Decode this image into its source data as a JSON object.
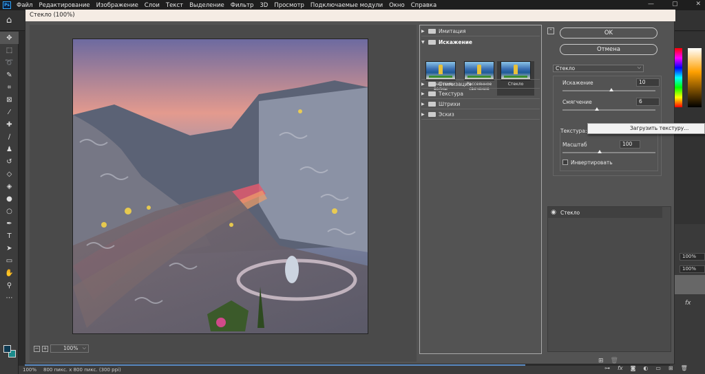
{
  "app": {
    "logo": "Ps",
    "menu": [
      "Файл",
      "Редактирование",
      "Изображение",
      "Слои",
      "Текст",
      "Выделение",
      "Фильтр",
      "3D",
      "Просмотр",
      "Подключаемые модули",
      "Окно",
      "Справка"
    ],
    "window_controls": [
      "—",
      "▢",
      "✕"
    ]
  },
  "toolbar": {
    "icons": [
      "move-icon",
      "marquee-icon",
      "lasso-icon",
      "quick-select-icon",
      "crop-icon",
      "frame-icon",
      "eyedropper-icon",
      "healing-icon",
      "brush-icon",
      "stamp-icon",
      "history-brush-icon",
      "eraser-icon",
      "bucket-icon",
      "blur-icon",
      "dodge-icon",
      "pen-icon",
      "type-icon",
      "path-select-icon",
      "rectangle-icon",
      "hand-icon",
      "zoom-icon",
      "more-icon"
    ],
    "foreground": "#0e3a52",
    "background": "#1a8a8a"
  },
  "status": {
    "zoom": "100%",
    "info": "800 пикс. x 800 пикс. (300 ppi)"
  },
  "right_panel": {
    "fields": [
      "100%",
      "100%"
    ],
    "fx_label": "fx"
  },
  "dialog": {
    "title": "Стекло (100%)",
    "zoom": "100%",
    "zoom_minus": "−",
    "zoom_plus": "+",
    "categories": [
      {
        "label": "Имитация",
        "open": false
      },
      {
        "label": "Искажение",
        "open": true
      },
      {
        "label": "Стилизация",
        "open": false
      },
      {
        "label": "Текстура",
        "open": false
      },
      {
        "label": "Штрихи",
        "open": false
      },
      {
        "label": "Эскиз",
        "open": false
      }
    ],
    "thumbs": [
      {
        "label": "Океанские волны",
        "selected": false
      },
      {
        "label": "Рассеянное свечение",
        "selected": false
      },
      {
        "label": "Стекло",
        "selected": true
      }
    ],
    "ok": "OK",
    "cancel": "Отмена",
    "filter_select": "Стекло",
    "params": {
      "distortion": {
        "label": "Искажение",
        "value": "10",
        "level": 0.5
      },
      "smoothness": {
        "label": "Смягчение",
        "value": "6",
        "level": 0.35
      },
      "texture": {
        "label": "Текстура:",
        "value": "2"
      },
      "scale": {
        "label": "Масштаб",
        "value": "100",
        "level": 0.38
      },
      "invert": {
        "label": "Инвертировать",
        "checked": false
      }
    },
    "popup": "Загрузить текстуру...",
    "layer": {
      "name": "Стекло"
    },
    "footer_icons": [
      "new-layer-icon",
      "trash-icon"
    ]
  },
  "bottom_icons": [
    "link-icon",
    "fx-icon",
    "mask-icon",
    "adjustment-icon",
    "folder-icon",
    "add-icon",
    "trash-icon"
  ]
}
